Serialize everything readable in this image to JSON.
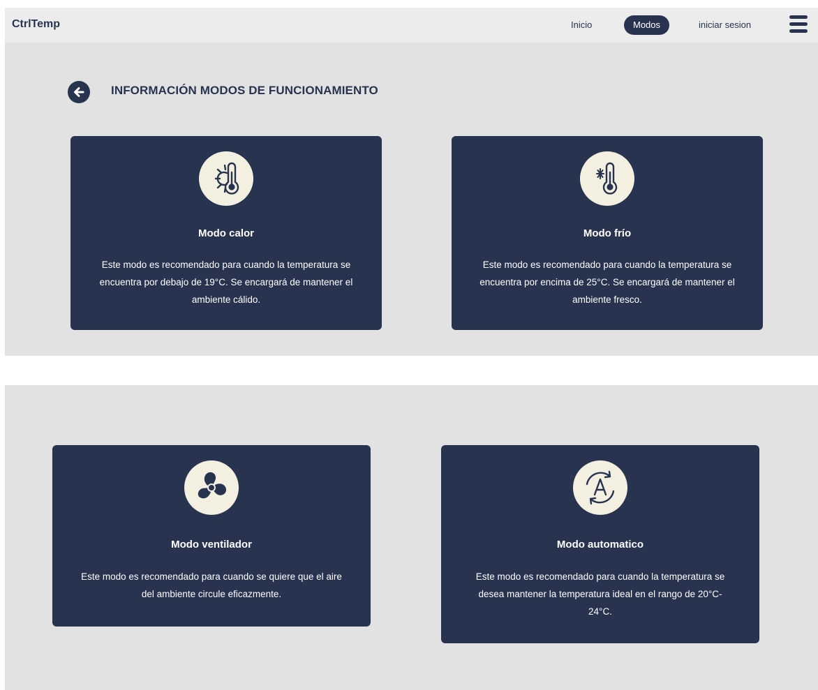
{
  "navbar": {
    "brand": "CtrlTemp",
    "links": {
      "inicio": "Inicio",
      "modos": "Modos",
      "sesion": "iniciar sesion"
    },
    "menu_icon": "hamburger-menu-icon"
  },
  "header": {
    "back_icon": "arrow-left-icon",
    "title": "INFORMACIÓN MODOS DE FUNCIONAMIENTO"
  },
  "modes": [
    {
      "icon": "thermometer-sun-icon",
      "title": "Modo calor",
      "description": "Este modo es recomendado para cuando la temperatura se encuentra por debajo de 19°C. Se encargará de mantener el ambiente cálido."
    },
    {
      "icon": "thermometer-snowflake-icon",
      "title": "Modo frío",
      "description": "Este modo es recomendado para cuando la temperatura se encuentra por encima de 25°C. Se encargará de mantener el ambiente fresco."
    },
    {
      "icon": "fan-icon",
      "title": "Modo ventilador",
      "description": "Este modo es recomendado para cuando se quiere que el aire del ambiente circule eficazmente."
    },
    {
      "icon": "auto-mode-icon",
      "title": "Modo automatico",
      "description": "Este modo es recomendado para cuando la temperatura se desea mantener la temperatura ideal en el rango de 20°C- 24°C."
    }
  ],
  "colors": {
    "primary": "#283350",
    "icon_bg": "#f3f0e1",
    "section_bg": "#e2e2e2",
    "navbar_bg": "#ececec"
  }
}
